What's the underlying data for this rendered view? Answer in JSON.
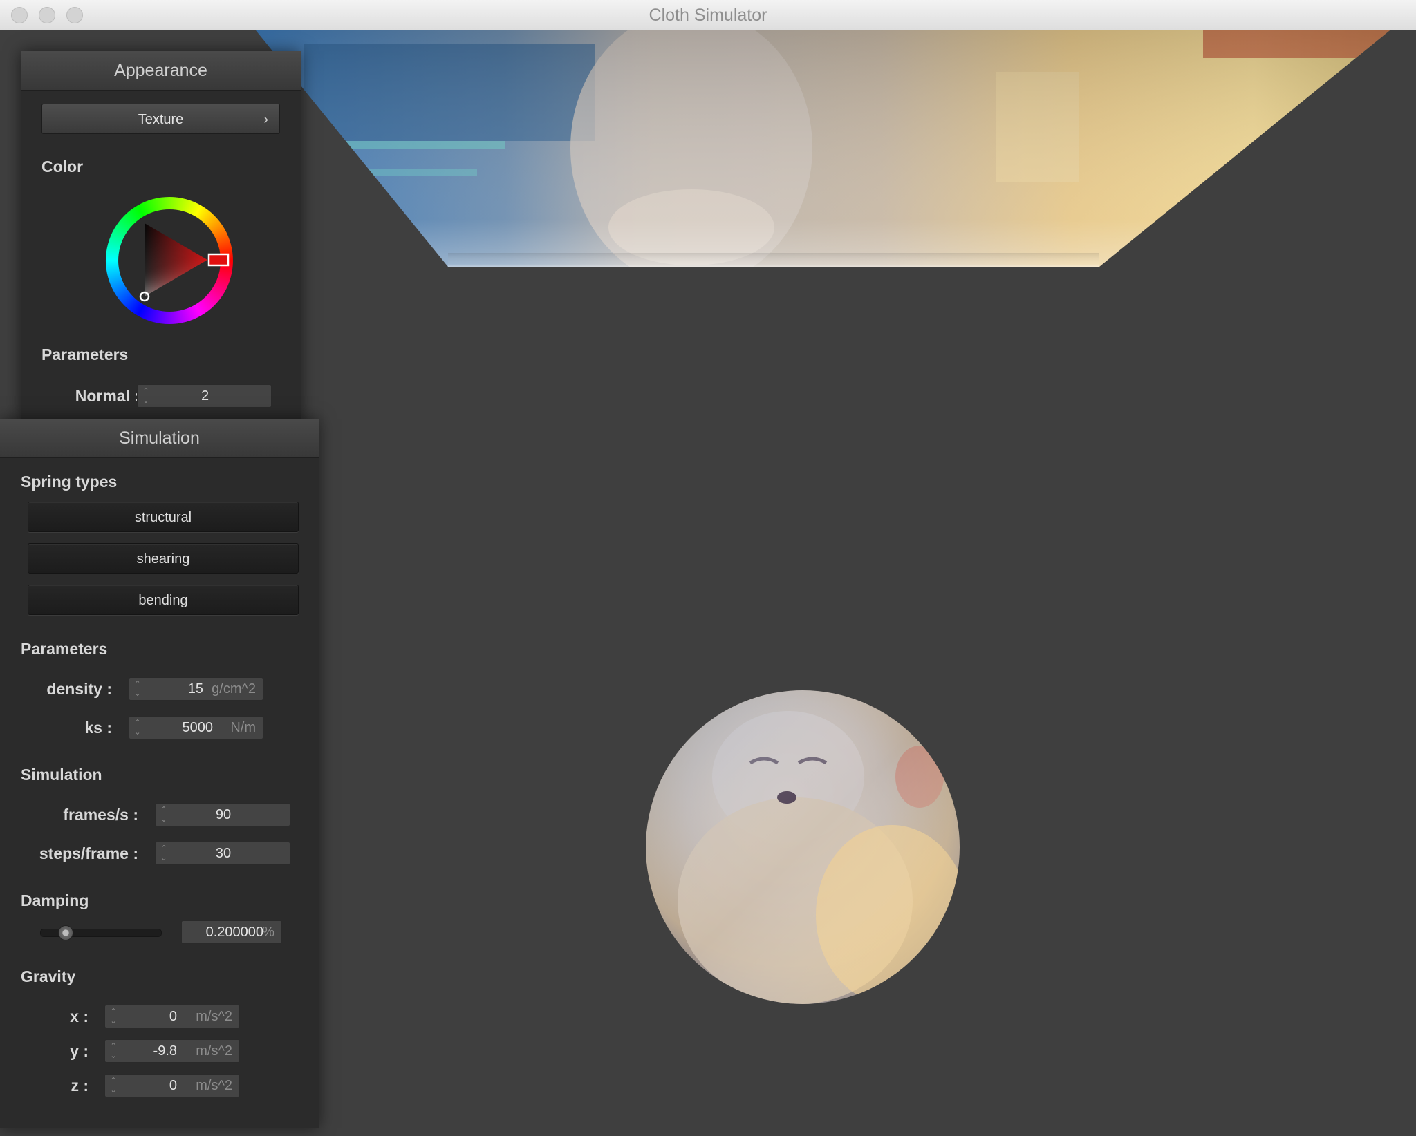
{
  "window": {
    "title": "Cloth Simulator"
  },
  "appearance": {
    "header": "Appearance",
    "texture_button": "Texture",
    "color_label": "Color",
    "selected_color": "#e01010",
    "parameters_label": "Parameters",
    "normal": {
      "label": "Normal :",
      "value": "2"
    }
  },
  "simulation": {
    "header": "Simulation",
    "spring_types_label": "Spring types",
    "spring_buttons": [
      "structural",
      "shearing",
      "bending"
    ],
    "parameters_label": "Parameters",
    "density": {
      "label": "density :",
      "value": "15",
      "unit": "g/cm^2"
    },
    "ks": {
      "label": "ks :",
      "value": "5000",
      "unit": "N/m"
    },
    "simulation_label": "Simulation",
    "fps": {
      "label": "frames/s :",
      "value": "90"
    },
    "steps": {
      "label": "steps/frame :",
      "value": "30"
    },
    "damping_label": "Damping",
    "damping": {
      "value": "0.200000",
      "unit": "%",
      "level": 0.2
    },
    "gravity_label": "Gravity",
    "gravity": [
      {
        "label": "x :",
        "value": "0",
        "unit": "m/s^2"
      },
      {
        "label": "y :",
        "value": "-9.8",
        "unit": "m/s^2"
      },
      {
        "label": "z :",
        "value": "0",
        "unit": "m/s^2"
      }
    ]
  }
}
